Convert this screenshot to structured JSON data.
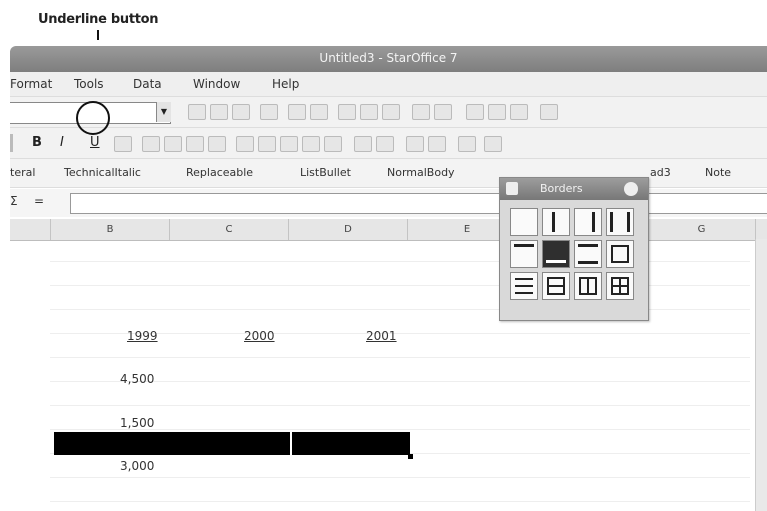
{
  "callout": {
    "label": "Underline button"
  },
  "window": {
    "title": "Untitled3 - StarOffice 7"
  },
  "menubar": {
    "items": [
      "Format",
      "Tools",
      "Data",
      "Window",
      "Help"
    ]
  },
  "format_toolbar": {
    "bold": "B",
    "italic": "I",
    "underline": "U"
  },
  "stylebar": {
    "items": [
      "teral",
      "TechnicalItalic",
      "Replaceable",
      "ListBullet",
      "NormalBody",
      "ad3",
      "Note"
    ]
  },
  "formula": {
    "sum_symbol": "Σ",
    "equals": "="
  },
  "columns": [
    "B",
    "C",
    "D",
    "E",
    "G"
  ],
  "sheet": {
    "years": [
      "1999",
      "2000",
      "2001"
    ],
    "values": [
      "4,500",
      "1,500",
      "3,000"
    ]
  },
  "borders_panel": {
    "title": "Borders"
  }
}
